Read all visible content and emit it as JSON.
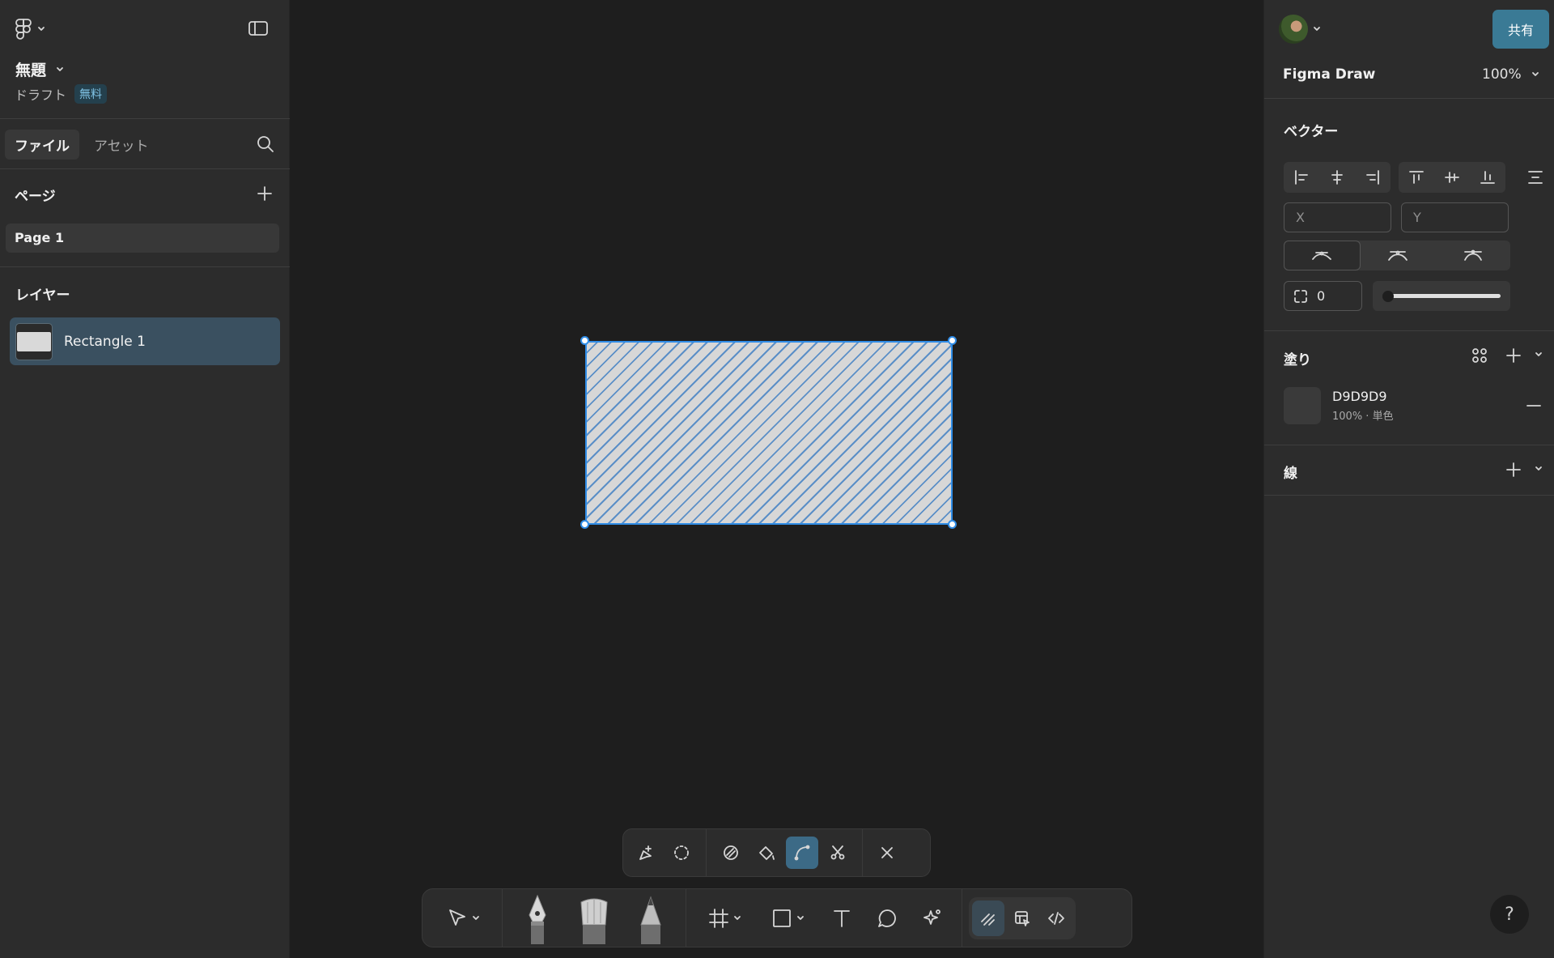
{
  "left_panel": {
    "file_title": "無題",
    "draft_label": "ドラフト",
    "plan_badge": "無料",
    "tabs": [
      {
        "label": "ファイル",
        "active": true
      },
      {
        "label": "アセット",
        "active": false
      }
    ],
    "pages_title": "ページ",
    "pages": [
      "Page 1"
    ],
    "layers_title": "レイヤー",
    "layers": [
      {
        "name": "Rectangle 1",
        "selected": true
      }
    ]
  },
  "canvas": {
    "selected_object": "Rectangle 1",
    "selection_color": "#2f8ce6",
    "vector_tools": [
      "add-point-icon",
      "lasso-icon",
      "shape-builder-icon",
      "paint-bucket-icon",
      "bend-icon",
      "cut-icon",
      "close-icon"
    ],
    "active_vector_tool": "bend-icon",
    "main_tools": [
      "move-icon",
      "pen-icon",
      "brush-icon",
      "pencil-icon",
      "frame-icon",
      "rectangle-icon",
      "text-icon",
      "comment-icon",
      "actions-icon",
      "draw-mode-icon",
      "design-mode-icon",
      "dev-mode-icon"
    ]
  },
  "right_panel": {
    "share_label": "共有",
    "mode_label": "Figma Draw",
    "zoom": "100%",
    "vector_section": "ベクター",
    "x_placeholder": "X",
    "y_placeholder": "Y",
    "corner_radius": "0",
    "fill_section": "塗り",
    "fill_hex": "D9D9D9",
    "fill_sub": "100% · 単色",
    "stroke_section": "線",
    "help": "?"
  },
  "colors": {
    "accent": "#3a7a95",
    "panel": "#2c2c2c",
    "canvas": "#1e1e1e",
    "selected_layer": "#3a5060"
  }
}
